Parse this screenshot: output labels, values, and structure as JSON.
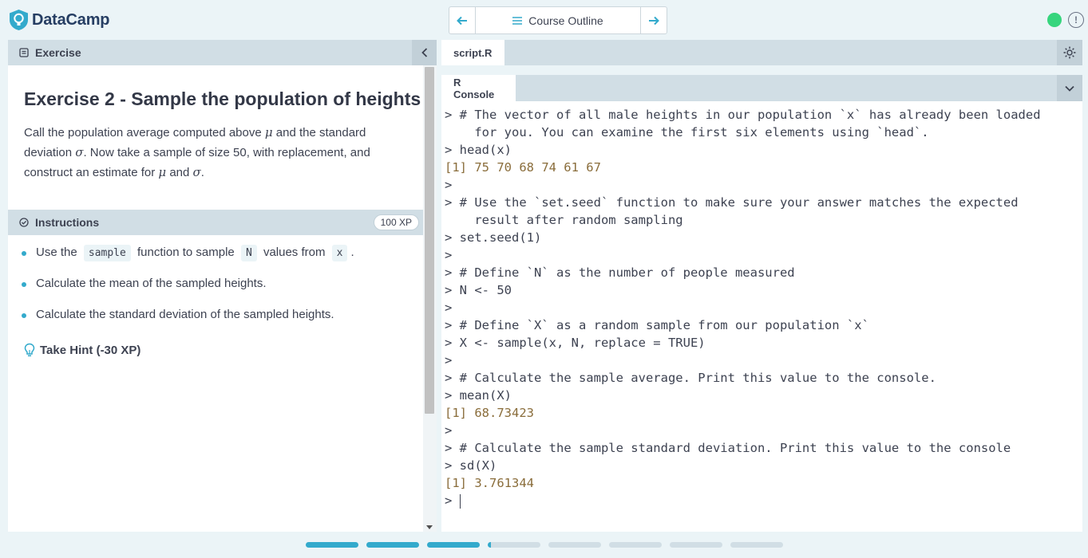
{
  "brand": {
    "name": "DataCamp",
    "logo_icon": "datacamp-shield-icon",
    "accent": "#33aacc"
  },
  "nav": {
    "prev_icon": "arrow-left-icon",
    "next_icon": "arrow-right-icon",
    "outline_icon": "menu-icon",
    "outline_label": "Course Outline"
  },
  "status": {
    "online_color": "#36d57d",
    "alert_glyph": "!"
  },
  "exercise_panel": {
    "header": "Exercise",
    "title": "Exercise 2 - Sample the population of heights",
    "desc": {
      "p1": "Call the population average computed above ",
      "mu": "μ",
      "p2": " and the standard deviation ",
      "sigma": "σ",
      "p3": ". Now take a sample of size 50, with replacement, and construct an estimate for ",
      "mu2": "μ",
      "p4": " and ",
      "sigma2": "σ",
      "p5": "."
    }
  },
  "instructions": {
    "header": "Instructions",
    "xp": "100 XP",
    "item1": {
      "a": "Use the",
      "code1": "sample",
      "b": "function to sample",
      "code2": "N",
      "c": "values from",
      "code3": "x",
      "d": "."
    },
    "item2": "Calculate the mean of the sampled heights.",
    "item3": "Calculate the standard deviation of the sampled heights.",
    "hint": "Take Hint (-30 XP)"
  },
  "editor": {
    "tab": "script.R",
    "settings_icon": "sun-icon"
  },
  "console": {
    "tab": "R Console",
    "lines": [
      {
        "p": "> ",
        "t": "# The vector of all male heights in our population `x` has already been loaded"
      },
      {
        "p": "  ",
        "t": "  for you. You can examine the first six elements using `head`."
      },
      {
        "p": "> ",
        "t": "head(x)"
      },
      {
        "p": "",
        "t": "[1] 75 70 68 74 61 67",
        "out": true
      },
      {
        "p": "> ",
        "t": ""
      },
      {
        "p": "> ",
        "t": "# Use the `set.seed` function to make sure your answer matches the expected"
      },
      {
        "p": "  ",
        "t": "  result after random sampling"
      },
      {
        "p": "> ",
        "t": "set.seed(1)"
      },
      {
        "p": "> ",
        "t": ""
      },
      {
        "p": "> ",
        "t": "# Define `N` as the number of people measured"
      },
      {
        "p": "> ",
        "t": "N <- 50"
      },
      {
        "p": "> ",
        "t": ""
      },
      {
        "p": "> ",
        "t": "# Define `X` as a random sample from our population `x`"
      },
      {
        "p": "> ",
        "t": "X <- sample(x, N, replace = TRUE)"
      },
      {
        "p": "> ",
        "t": ""
      },
      {
        "p": "> ",
        "t": "# Calculate the sample average. Print this value to the console."
      },
      {
        "p": "> ",
        "t": "mean(X)"
      },
      {
        "p": "",
        "t": "[1] 68.73423",
        "out": true
      },
      {
        "p": "> ",
        "t": ""
      },
      {
        "p": "> ",
        "t": "# Calculate the sample standard deviation. Print this value to the console"
      },
      {
        "p": "> ",
        "t": "sd(X)"
      },
      {
        "p": "",
        "t": "[1] 3.761344",
        "out": true
      },
      {
        "p": "> ",
        "t": "",
        "cursor": true
      }
    ]
  },
  "progress": {
    "total": 8,
    "completed": 3,
    "current": 4
  }
}
